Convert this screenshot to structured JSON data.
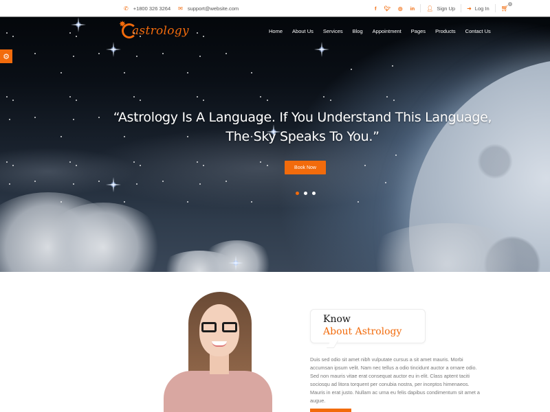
{
  "topbar": {
    "phone": "+1800 326 3264",
    "email": "support@website.com",
    "social": [
      {
        "name": "facebook",
        "glyph": "f"
      },
      {
        "name": "twitter",
        "glyph": "t"
      },
      {
        "name": "instagram",
        "glyph": "◎"
      },
      {
        "name": "linkedin",
        "glyph": "in"
      }
    ],
    "signup_label": "Sign Up",
    "login_label": "Log In",
    "cart_count": "0"
  },
  "header": {
    "logo_text": "astrology",
    "nav": [
      "Home",
      "About Us",
      "Services",
      "Blog",
      "Appointment",
      "Pages",
      "Products",
      "Contact Us"
    ]
  },
  "hero": {
    "quote_line1": "“Astrology Is A Language. If You Understand This Language,",
    "quote_line2": "The Sky Speaks To You.”",
    "cta_label": "Book Now",
    "slides": 3,
    "active_slide": 1
  },
  "about": {
    "heading_line1": "Know",
    "heading_line2": "About Astrology",
    "paragraph": "Duis sed odio sit amet nibh vulputate cursus a sit amet mauris. Morbi accumsan ipsum velit. Nam nec tellus a odio tincidunt auctor a ornare odio. Sed non mauris vitae erat consequat auctor eu in elit. Class aptent taciti sociosqu ad litora torquent per conubia nostra, per inceptos himenaeos. Mauris in erat justo. Nullam ac urna eu felis dapibus condimentum sit amet a augue."
  },
  "colors": {
    "accent": "#f26b0c"
  }
}
